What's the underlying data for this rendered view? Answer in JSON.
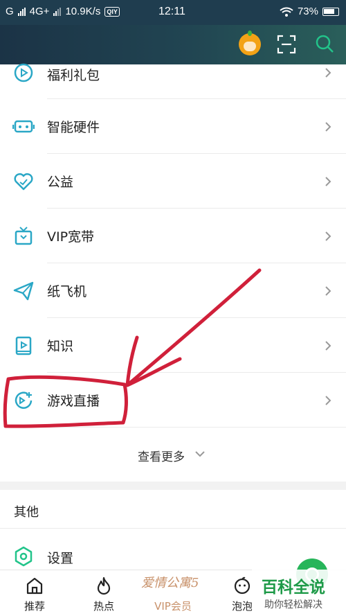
{
  "status_bar": {
    "carrier": "G",
    "network": "4G+",
    "speed": "10.9K/s",
    "app_badge": "QIY",
    "time": "12:11",
    "battery": "73%"
  },
  "header": {
    "avatar_icon": "mascot-avatar-icon",
    "scan_icon": "scan-icon",
    "search_icon": "search-icon",
    "accent_color": "#22c48a"
  },
  "menu": {
    "items": [
      {
        "label": "福利礼包",
        "icon": "play-circle-icon"
      },
      {
        "label": "智能硬件",
        "icon": "vr-glasses-icon"
      },
      {
        "label": "公益",
        "icon": "heart-icon"
      },
      {
        "label": "VIP宽带",
        "icon": "tv-icon"
      },
      {
        "label": "纸飞机",
        "icon": "paper-plane-icon"
      },
      {
        "label": "知识",
        "icon": "book-icon"
      },
      {
        "label": "游戏直播",
        "icon": "game-live-icon"
      }
    ],
    "more_label": "查看更多"
  },
  "other": {
    "heading": "其他",
    "settings_label": "设置"
  },
  "bottom_nav": {
    "tabs": [
      {
        "label": "推荐",
        "icon": "home-icon"
      },
      {
        "label": "热点",
        "icon": "flame-icon"
      },
      {
        "label": "VIP会员",
        "icon": "vip-logo",
        "logo_text": "爱情公寓5"
      },
      {
        "label": "泡泡",
        "icon": "bubble-face-icon"
      }
    ]
  },
  "watermark": {
    "title": "百科全说",
    "subtitle": "助你轻松解决"
  },
  "colors": {
    "icon_teal": "#2aa7c6",
    "annotation_red": "#d0203a",
    "vip_gold": "#c8916a"
  }
}
